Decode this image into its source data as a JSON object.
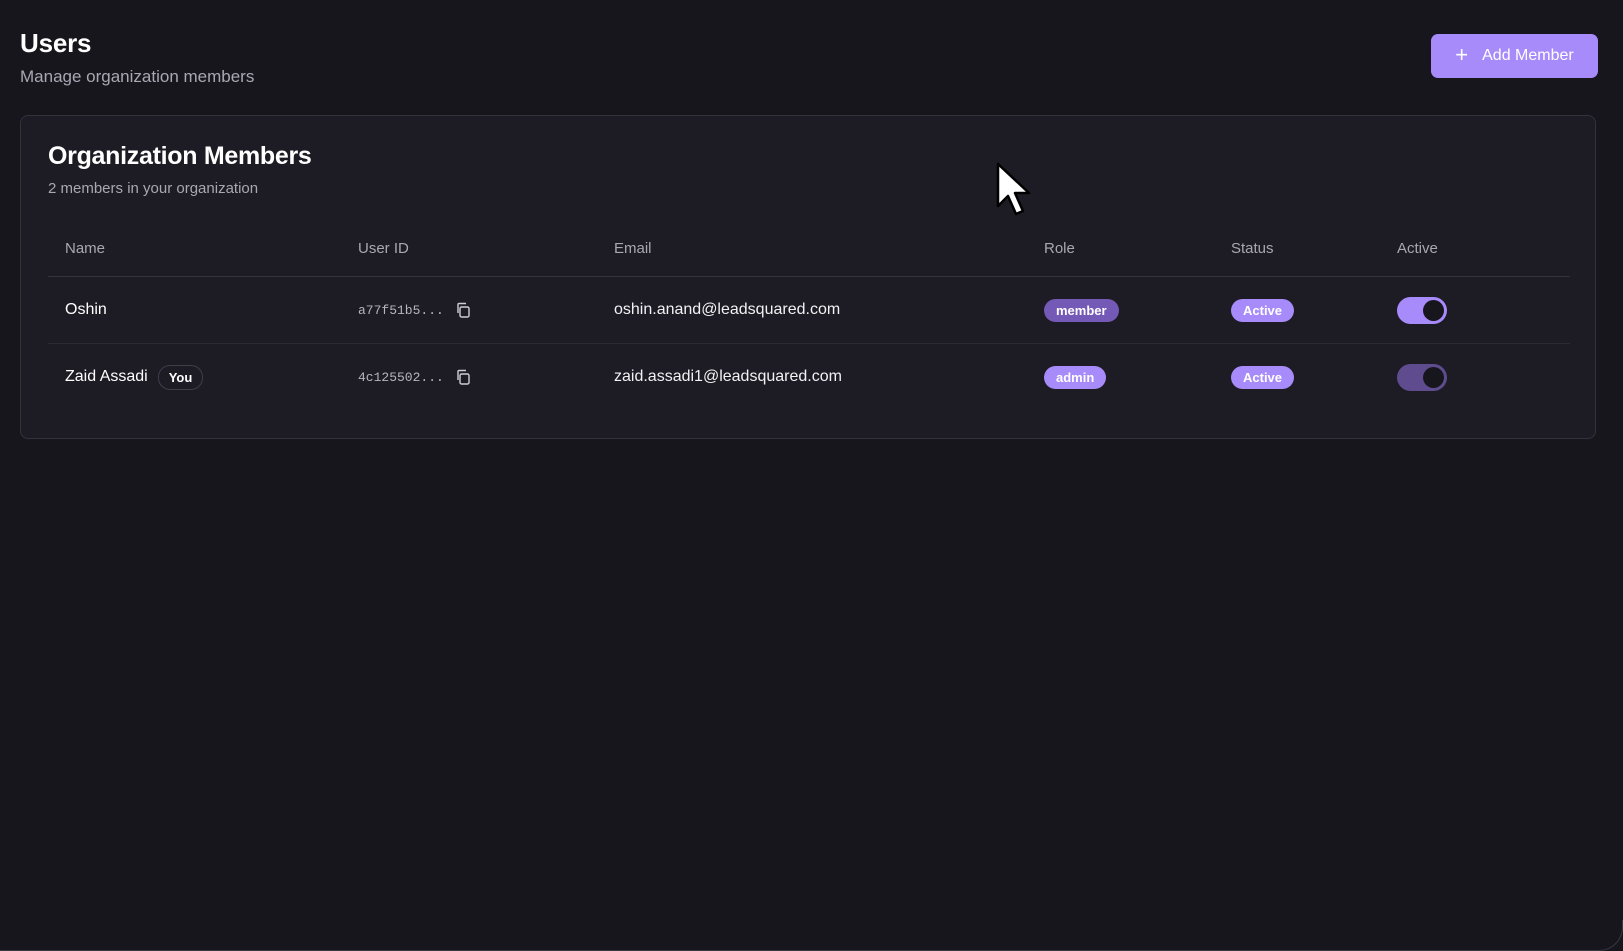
{
  "header": {
    "title": "Users",
    "subtitle": "Manage organization members",
    "add_button_label": "Add Member",
    "add_button_icon": "plus-icon"
  },
  "card": {
    "title": "Organization Members",
    "subtitle": "2 members in your organization"
  },
  "table": {
    "columns": [
      "Name",
      "User ID",
      "Email",
      "Role",
      "Status",
      "Active"
    ],
    "rows": [
      {
        "name": "Oshin",
        "you_badge": "",
        "user_id": "a77f51b5...",
        "email": "oshin.anand@leadsquared.com",
        "role": "member",
        "status": "Active",
        "active": true
      },
      {
        "name": "Zaid Assadi",
        "you_badge": "You",
        "user_id": "4c125502...",
        "email": "zaid.assadi1@leadsquared.com",
        "role": "admin",
        "status": "Active",
        "active": true
      }
    ]
  },
  "colors": {
    "background": "#17161c",
    "card": "#1d1b23",
    "accent": "#a78bfa",
    "accent_dim": "#7559b6"
  }
}
